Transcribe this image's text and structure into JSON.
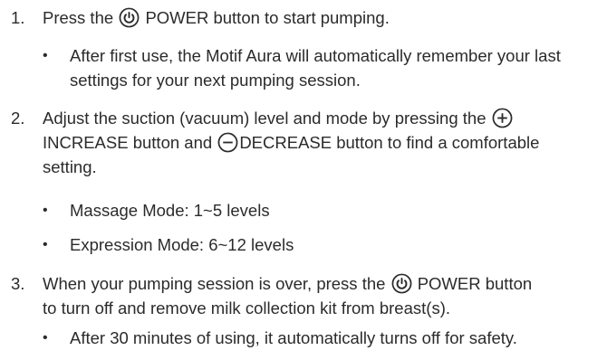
{
  "steps": [
    {
      "number": "1.",
      "before": "Press the",
      "icon": "power-icon",
      "after": "POWER button to start pumping.",
      "bullets": [
        "After first use, the Motif Aura will automatically remember your last settings for your next pumping session."
      ]
    },
    {
      "number": "2.",
      "line1_before": "Adjust the suction (vacuum) level and mode by pressing the",
      "icon_plus": "plus-circle-icon",
      "line2_a": "INCREASE button and",
      "icon_minus": "minus-circle-icon",
      "line2_b": "DECREASE button to find a comfortable",
      "line3": "setting.",
      "bullets": [
        "Massage Mode: 1~5 levels",
        "Expression Mode: 6~12 levels"
      ]
    },
    {
      "number": "3.",
      "before": "When your pumping session is over, press the",
      "icon": "power-icon",
      "after": "POWER button",
      "line2": "to turn off and remove milk collection kit from breast(s).",
      "bullets": [
        "After 30 minutes of using, it automatically turns off for safety."
      ]
    }
  ],
  "bullet_glyph": "•",
  "colors": {
    "text": "#2b2b2b",
    "background": "#ffffff"
  }
}
